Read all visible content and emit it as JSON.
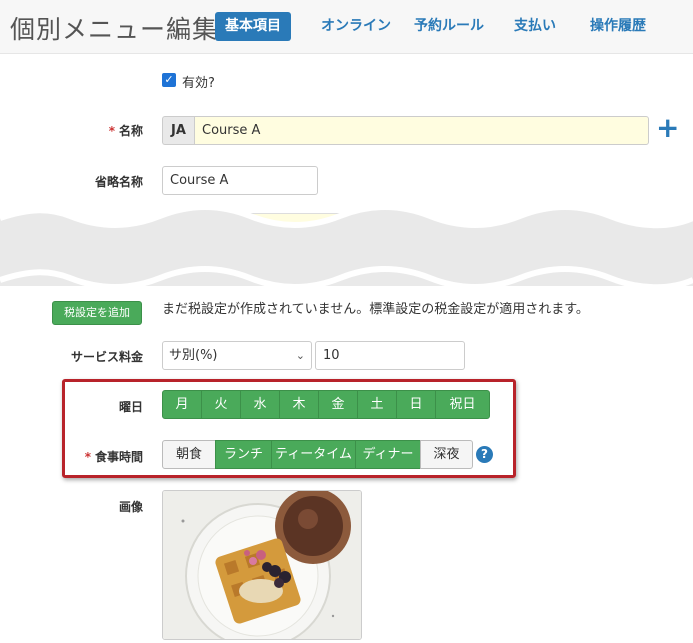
{
  "header": {
    "title": "個別メニュー編集",
    "tabs": [
      {
        "label": "基本項目",
        "active": true
      },
      {
        "label": "オンライン",
        "active": false
      },
      {
        "label": "予約ルール",
        "active": false
      },
      {
        "label": "支払い",
        "active": false
      },
      {
        "label": "操作履歴",
        "active": false
      }
    ]
  },
  "form": {
    "enabled": {
      "label": "有効?",
      "checked": true
    },
    "name": {
      "label": "名称",
      "lang": "JA",
      "value": "Course A"
    },
    "abbr": {
      "label": "省略名称",
      "value": "Course A"
    },
    "tax": {
      "button": "税設定を追加",
      "message": "まだ税設定が作成されていません。標準設定の税金設定が適用されます。"
    },
    "service_fee": {
      "label": "サービス料金",
      "selected": "サ別(%)",
      "value": "10"
    },
    "weekdays": {
      "label": "曜日",
      "items": [
        "月",
        "火",
        "水",
        "木",
        "金",
        "土",
        "日",
        "祝日"
      ]
    },
    "meal_time": {
      "label": "食事時間",
      "items": [
        {
          "label": "朝食",
          "on": false
        },
        {
          "label": "ランチ",
          "on": true
        },
        {
          "label": "ティータイム",
          "on": true
        },
        {
          "label": "ディナー",
          "on": true
        },
        {
          "label": "深夜",
          "on": false
        }
      ]
    },
    "image": {
      "label": "画像"
    }
  },
  "colors": {
    "primary": "#2a7ab8",
    "green": "#4aaa5a",
    "highlight": "#b8232a",
    "required": "#cc3333"
  }
}
